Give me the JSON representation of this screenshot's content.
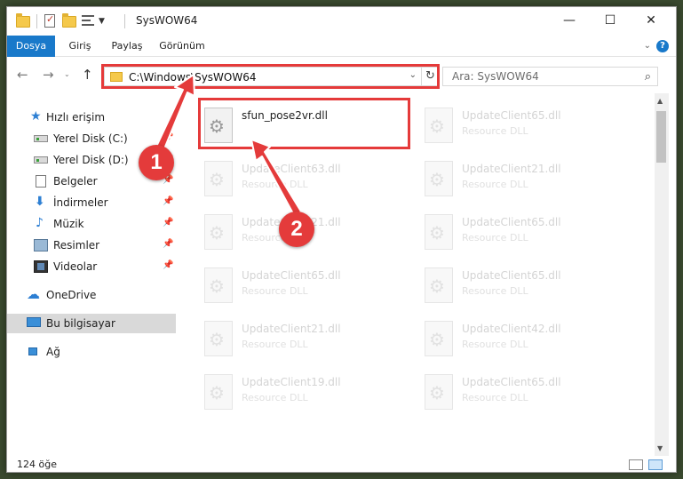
{
  "window": {
    "title": "SysWOW64"
  },
  "window_controls": {
    "minimize": "—",
    "maximize": "☐",
    "close": "✕"
  },
  "ribbon": {
    "tabs": [
      {
        "label": "Dosya"
      },
      {
        "label": "Giriş"
      },
      {
        "label": "Paylaş"
      },
      {
        "label": "Görünüm"
      }
    ],
    "expand_chevron": "⌄",
    "help": "?"
  },
  "nav": {
    "back": "←",
    "forward": "→",
    "recent_caret": "⌄",
    "up": "↑",
    "address": "C:\\Windows\\SysWOW64",
    "address_dropdown": "⌄",
    "refresh": "↻",
    "search_placeholder": "Ara: SysWOW64",
    "search_icon": "⌕"
  },
  "sidebar": {
    "items": [
      {
        "label": "Hızlı erişim",
        "icon": "star-icon"
      },
      {
        "label": "Yerel Disk (C:)",
        "icon": "drive-icon",
        "pinned": true
      },
      {
        "label": "Yerel Disk (D:)",
        "icon": "drive-icon",
        "pinned": true
      },
      {
        "label": "Belgeler",
        "icon": "document-icon",
        "pinned": true
      },
      {
        "label": "İndirmeler",
        "icon": "download-icon",
        "pinned": true
      },
      {
        "label": "Müzik",
        "icon": "music-icon",
        "pinned": true
      },
      {
        "label": "Resimler",
        "icon": "pictures-icon",
        "pinned": true
      },
      {
        "label": "Videolar",
        "icon": "videos-icon",
        "pinned": true
      },
      {
        "label": "OneDrive",
        "icon": "cloud-icon"
      },
      {
        "label": "Bu bilgisayar",
        "icon": "computer-icon",
        "selected": true
      },
      {
        "label": "Ağ",
        "icon": "network-icon"
      }
    ],
    "pin_glyph": "📌"
  },
  "files": [
    {
      "name": "sfun_pose2vr.dll",
      "type": ""
    },
    {
      "name": "UpdateClient65.dll",
      "type": "Resource DLL"
    },
    {
      "name": "UpdateClient63.dll",
      "type": "Resource DLL"
    },
    {
      "name": "UpdateClient21.dll",
      "type": "Resource DLL"
    },
    {
      "name": "UpdateClient21.dll",
      "type": "Resource DLL"
    },
    {
      "name": "UpdateClient65.dll",
      "type": "Resource DLL"
    },
    {
      "name": "UpdateClient65.dll",
      "type": "Resource DLL"
    },
    {
      "name": "UpdateClient65.dll",
      "type": "Resource DLL"
    },
    {
      "name": "UpdateClient21.dll",
      "type": "Resource DLL"
    },
    {
      "name": "UpdateClient42.dll",
      "type": "Resource DLL"
    },
    {
      "name": "UpdateClient19.dll",
      "type": "Resource DLL"
    },
    {
      "name": "UpdateClient65.dll",
      "type": "Resource DLL"
    }
  ],
  "status": {
    "item_count": "124 öğe"
  },
  "annotations": {
    "step1": "1",
    "step2": "2"
  },
  "colors": {
    "accent": "#1979ca",
    "highlight_red": "#e53a3a",
    "selection": "#d9d9d9"
  }
}
